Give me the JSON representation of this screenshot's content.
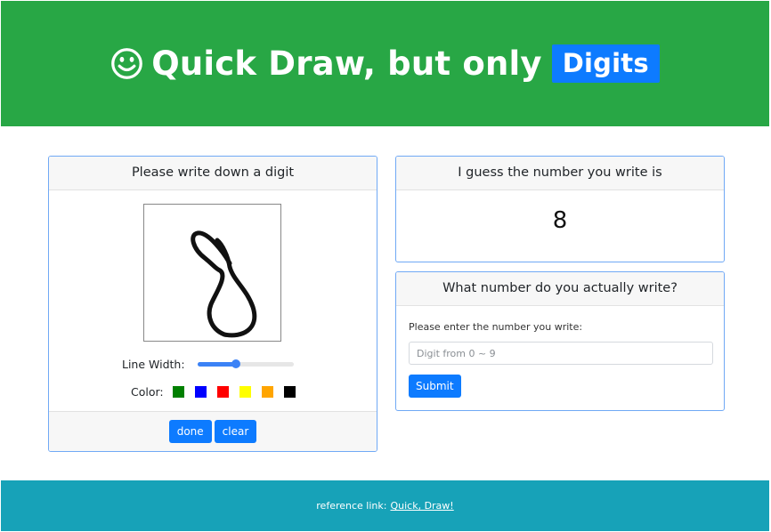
{
  "header": {
    "title": "Quick Draw, but only",
    "badge": "Digits",
    "icon": "smiley-face-icon",
    "bg_color": "#28a745",
    "badge_color": "#0d7bff"
  },
  "draw_card": {
    "header": "Please write down a digit",
    "line_width_label": "Line Width:",
    "line_width_value": 0.4,
    "color_label": "Color:",
    "colors": [
      "#008000",
      "#0000ff",
      "#ff0000",
      "#ffff00",
      "#ffa500",
      "#000000"
    ],
    "done_label": "done",
    "clear_label": "clear"
  },
  "guess_card": {
    "header": "I guess the number you write is",
    "value": "8"
  },
  "answer_card": {
    "header": "What number do you actually write?",
    "label": "Please enter the number you write:",
    "placeholder": "Digit from 0 ~ 9",
    "value": "",
    "submit_label": "Submit"
  },
  "footer": {
    "text": "reference link:",
    "link_text": "Quick, Draw!",
    "bg_color": "#17a2b8"
  }
}
